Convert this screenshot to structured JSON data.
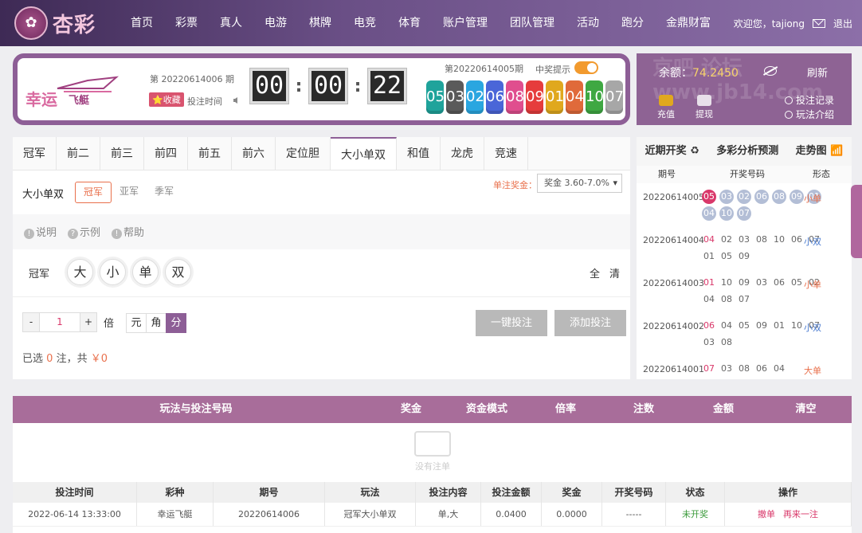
{
  "brand": {
    "logo_mark": "✿",
    "name": "杏彩"
  },
  "nav": {
    "items": [
      "首页",
      "彩票",
      "真人",
      "电游",
      "棋牌",
      "电竞",
      "体育",
      "账户管理",
      "团队管理",
      "活动",
      "跑分",
      "金鼎财富"
    ],
    "greeting": "欢迎您，tajiong",
    "logout": "退出"
  },
  "game": {
    "name_a": "幸运",
    "name_b": "飞艇",
    "current_issue": "第 20220614006 期",
    "favorite": "⭐收藏",
    "bet_time_label": "投注时间",
    "countdown": [
      "00",
      "00",
      "22"
    ],
    "last_issue": "第20220614005期",
    "hint_label": "中奖提示"
  },
  "last_draw": [
    {
      "n": "05",
      "c": "#1fa39b"
    },
    {
      "n": "03",
      "c": "#5a5a5a"
    },
    {
      "n": "02",
      "c": "#2aa6e0"
    },
    {
      "n": "06",
      "c": "#4a66d8"
    },
    {
      "n": "08",
      "c": "#e04e8e"
    },
    {
      "n": "09",
      "c": "#e63c3c"
    },
    {
      "n": "01",
      "c": "#e0a81e"
    },
    {
      "n": "04",
      "c": "#e06a3a"
    },
    {
      "n": "10",
      "c": "#3fa842"
    },
    {
      "n": "07",
      "c": "#a7a7a7"
    }
  ],
  "account": {
    "balance_label": "余额：",
    "balance": "74.2450",
    "refresh": "刷新",
    "deposit": "充值",
    "withdraw": "提现",
    "bet_record": "投注记录",
    "rules": "玩法介绍",
    "watermark": "京吧 论坛 www.jb14.com"
  },
  "tabs": [
    "冠军",
    "前二",
    "前三",
    "前四",
    "前五",
    "前六",
    "定位胆",
    "大小单双",
    "和值",
    "龙虎",
    "竞速"
  ],
  "active_tab": "大小单双",
  "sub": {
    "label": "大小单双",
    "options": [
      "冠军",
      "亚军",
      "季军"
    ],
    "prize_label": "单注奖金：",
    "prize_value": "奖金 3.60-7.0%"
  },
  "help": [
    "说明",
    "示例",
    "帮助"
  ],
  "pick": {
    "label": "冠军",
    "options": [
      "大",
      "小",
      "单",
      "双"
    ],
    "all": "全",
    "clear": "清"
  },
  "stepper": {
    "minus": "-",
    "value": "1",
    "plus": "+",
    "unit": "倍"
  },
  "units": [
    "元",
    "角",
    "分"
  ],
  "buttons": {
    "quick": "一键投注",
    "add": "添加投注"
  },
  "selected": {
    "prefix": "已选",
    "count": "0",
    "mid": "注，共",
    "amount": "￥0"
  },
  "trend": {
    "tabs": [
      "近期开奖 ♻",
      "多彩分析预测",
      "走势图 📶"
    ],
    "cols": [
      "期号",
      "开奖号码",
      "形态"
    ],
    "rows": [
      {
        "issue": "20220614005",
        "nums": [
          "05",
          "03",
          "02",
          "06",
          "08",
          "09",
          "01",
          "04",
          "10",
          "07"
        ],
        "state": "小单",
        "style": "ball",
        "sc": "#e9704c"
      },
      {
        "issue": "20220614004",
        "nums": [
          "04",
          "02",
          "03",
          "08",
          "10",
          "06",
          "07",
          "01",
          "05",
          "09"
        ],
        "state": "小双",
        "style": "plain",
        "sc": "#4a7bd0"
      },
      {
        "issue": "20220614003",
        "nums": [
          "01",
          "10",
          "09",
          "03",
          "06",
          "05",
          "02",
          "04",
          "08",
          "07"
        ],
        "state": "小单",
        "style": "plain",
        "sc": "#e9704c"
      },
      {
        "issue": "20220614002",
        "nums": [
          "06",
          "04",
          "05",
          "09",
          "01",
          "10",
          "07",
          "03",
          "08"
        ],
        "state": "小双",
        "style": "plain",
        "sc": "#4a7bd0"
      },
      {
        "issue": "20220614001",
        "nums": [
          "07",
          "03",
          "08",
          "06",
          "04"
        ],
        "state": "大单",
        "style": "plain",
        "sc": "#e9704c"
      }
    ]
  },
  "cart": {
    "cols": [
      "玩法与投注号码",
      "奖金",
      "资金模式",
      "倍率",
      "注数",
      "金额",
      "清空"
    ],
    "empty": "没有注单"
  },
  "history": {
    "cols": [
      "投注时间",
      "彩种",
      "期号",
      "玩法",
      "投注内容",
      "投注金额",
      "奖金",
      "开奖号码",
      "状态",
      "操作"
    ],
    "rows": [
      {
        "time": "2022-06-14 13:33:00",
        "game": "幸运飞艇",
        "issue": "20220614006",
        "play": "冠军大小单双",
        "content": "单,大",
        "amount": "0.0400",
        "prize": "0.0000",
        "draw": "-----",
        "status": "未开奖",
        "op1": "撤单",
        "op2": "再来一注"
      }
    ]
  }
}
